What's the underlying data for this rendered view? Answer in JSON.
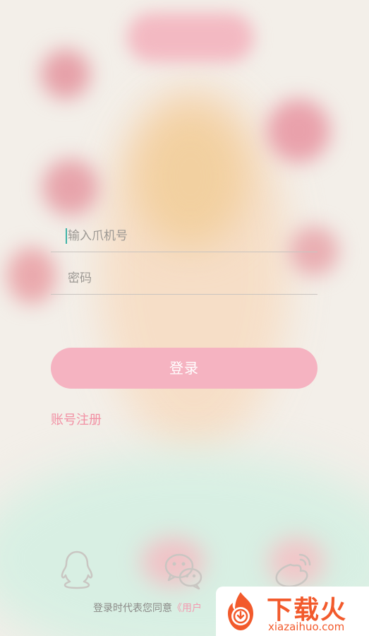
{
  "form": {
    "phone_placeholder": "输入爪机号",
    "password_placeholder": "密码",
    "login_label": "登录",
    "register_label": "账号注册"
  },
  "social": {
    "items": [
      "qq-icon",
      "wechat-icon",
      "weibo-icon"
    ]
  },
  "footer": {
    "agreement_prefix": "登录时代表您同意",
    "agreement_link": "《用户"
  },
  "watermark": {
    "brand_cn": "下载火",
    "brand_url": "xiazaihuo.com"
  },
  "colors": {
    "accent": "#f5b3c1",
    "register": "#f28fa3",
    "cursor": "#3fb3a7",
    "watermark": "#f25a2c"
  }
}
